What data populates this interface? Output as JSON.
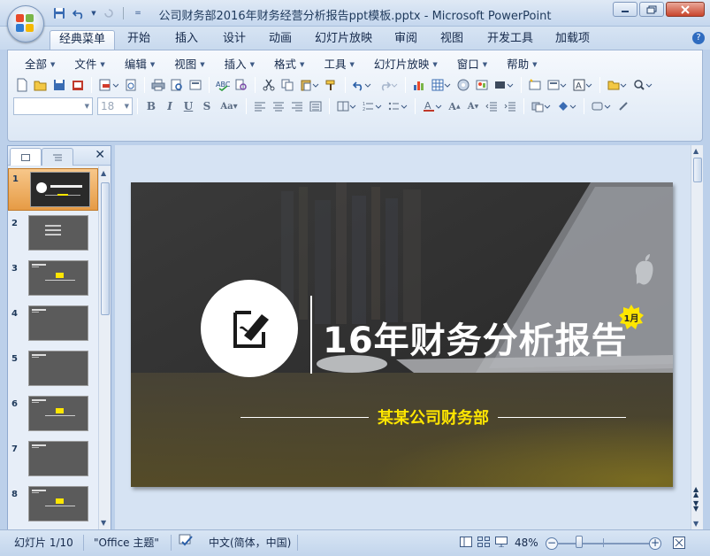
{
  "window": {
    "title": "公司财务部2016年财务经营分析报告ppt模板.pptx - Microsoft PowerPoint"
  },
  "ribbon_tabs": [
    "经典菜单",
    "开始",
    "插入",
    "设计",
    "动画",
    "幻灯片放映",
    "审阅",
    "视图",
    "开发工具",
    "加载项"
  ],
  "menu": [
    "全部",
    "文件",
    "编辑",
    "视图",
    "插入",
    "格式",
    "工具",
    "幻灯片放映",
    "窗口",
    "帮助"
  ],
  "format": {
    "font_name": "",
    "font_size": "18"
  },
  "thumbnails": [
    "1",
    "2",
    "3",
    "4",
    "5",
    "6",
    "7",
    "8"
  ],
  "slide": {
    "title": "16年财务分析报告",
    "badge": "1月",
    "subtitle": "某某公司财务部"
  },
  "status": {
    "slide_counter": "幻灯片 1/10",
    "theme": "\"Office 主题\"",
    "language": "中文(简体，中国)",
    "zoom": "48%"
  },
  "colors": {
    "accent_yellow": "#ffe600",
    "ribbon_blue": "#c8d9ee",
    "selection_orange": "#e69b45"
  }
}
